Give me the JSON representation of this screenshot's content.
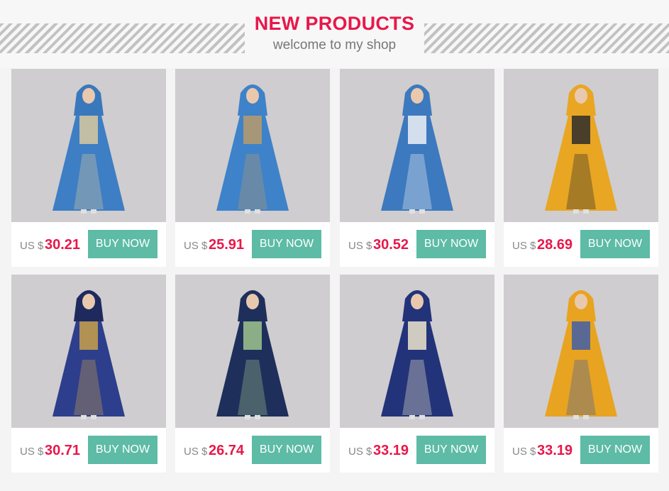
{
  "header": {
    "title": "NEW PRODUCTS",
    "subtitle": "welcome to my shop"
  },
  "currency_label": "US $",
  "buy_label": "BUY NOW",
  "products": [
    {
      "price": "30.21",
      "dress_color": "#3d7ec4",
      "accent_color": "#d9c8a0",
      "hijab_color": "#3a78bd",
      "dress_icon": "blue-embroidered-abaya-icon"
    },
    {
      "price": "25.91",
      "dress_color": "#3e82c9",
      "accent_color": "#b89b6a",
      "hijab_color": "#3e82c9",
      "dress_icon": "blue-abaya-icon"
    },
    {
      "price": "30.52",
      "dress_color": "#3d79be",
      "accent_color": "#eef1f6",
      "hijab_color": "#3d79be",
      "dress_icon": "blue-white-abaya-icon"
    },
    {
      "price": "28.69",
      "dress_color": "#e8a623",
      "accent_color": "#2b2b2b",
      "hijab_color": "#e8a623",
      "dress_icon": "yellow-black-abaya-icon"
    },
    {
      "price": "30.71",
      "dress_color": "#2d3e8c",
      "accent_color": "#c9a04a",
      "hijab_color": "#1e2a5e",
      "dress_icon": "navy-embroidered-abaya-icon"
    },
    {
      "price": "26.74",
      "dress_color": "#1f2f5c",
      "accent_color": "#9fc48d",
      "hijab_color": "#1f2f5c",
      "dress_icon": "navy-floral-abaya-icon"
    },
    {
      "price": "33.19",
      "dress_color": "#22337a",
      "accent_color": "#efe6cc",
      "hijab_color": "#22337a",
      "dress_icon": "navy-cream-abaya-icon"
    },
    {
      "price": "33.19",
      "dress_color": "#e8a320",
      "accent_color": "#3f5fa8",
      "hijab_color": "#e8a320",
      "dress_icon": "yellow-blue-abaya-icon"
    }
  ]
}
